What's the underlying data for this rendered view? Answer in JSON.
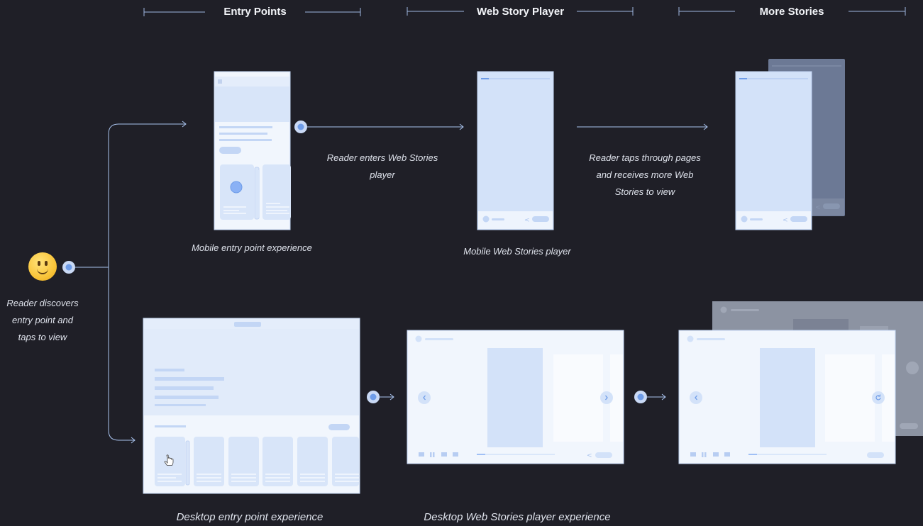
{
  "sections": {
    "entry_points": "Entry Points",
    "web_story_player": "Web Story Player",
    "more_stories": "More Stories"
  },
  "labels": {
    "reader_discovers": "Reader discovers entry point and taps to view",
    "reader_enters": "Reader enters Web Stories player",
    "reader_taps_through": "Reader taps through pages and receives more Web Stories to view",
    "mobile_entry": "Mobile entry point experience",
    "mobile_player": "Mobile Web Stories player",
    "desktop_entry": "Desktop entry point experience",
    "desktop_player": "Desktop Web Stories player experience"
  },
  "icons": {
    "reader": "smiley-face-icon",
    "cursor": "hand-cursor-icon"
  },
  "colors": {
    "background": "#1f1f27",
    "line": "#a9c3ee",
    "accent": "#8ab1f5",
    "panel_light": "#d3e2f9",
    "panel_lighter": "#f1f6fd",
    "panel_dim": "#6c7995"
  }
}
